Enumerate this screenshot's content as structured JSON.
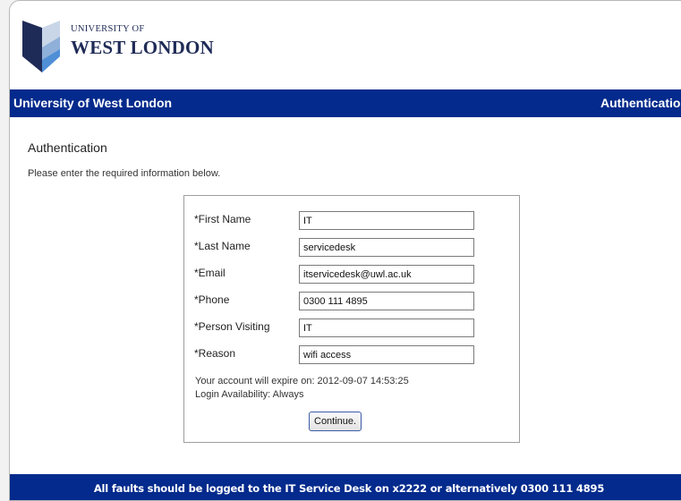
{
  "logo": {
    "line1": "UNIVERSITY OF",
    "line2": "WEST LONDON"
  },
  "header_bar": {
    "left": "University of West London",
    "right": "Authentication"
  },
  "page": {
    "title": "Authentication",
    "intro": "Please enter the required information below."
  },
  "form": {
    "fields": [
      {
        "label": "*First Name",
        "value": "IT"
      },
      {
        "label": "*Last Name",
        "value": "servicedesk"
      },
      {
        "label": "*Email",
        "value": "itservicedesk@uwl.ac.uk"
      },
      {
        "label": "*Phone",
        "value": "0300 111 4895"
      },
      {
        "label": "*Person Visiting",
        "value": "IT"
      },
      {
        "label": "*Reason",
        "value": "wifi access"
      }
    ],
    "expire_text": "Your account will expire on: 2012-09-07 14:53:25",
    "availability_text": "Login Availability: Always",
    "continue_label": "Continue."
  },
  "footer": {
    "text": "All faults should be logged to the IT Service Desk on x2222 or alternatively 0300 111 4895"
  },
  "colors": {
    "brand_blue": "#032a8c",
    "logo_navy": "#1f2b57",
    "logo_accent": "#4f8fd6"
  }
}
